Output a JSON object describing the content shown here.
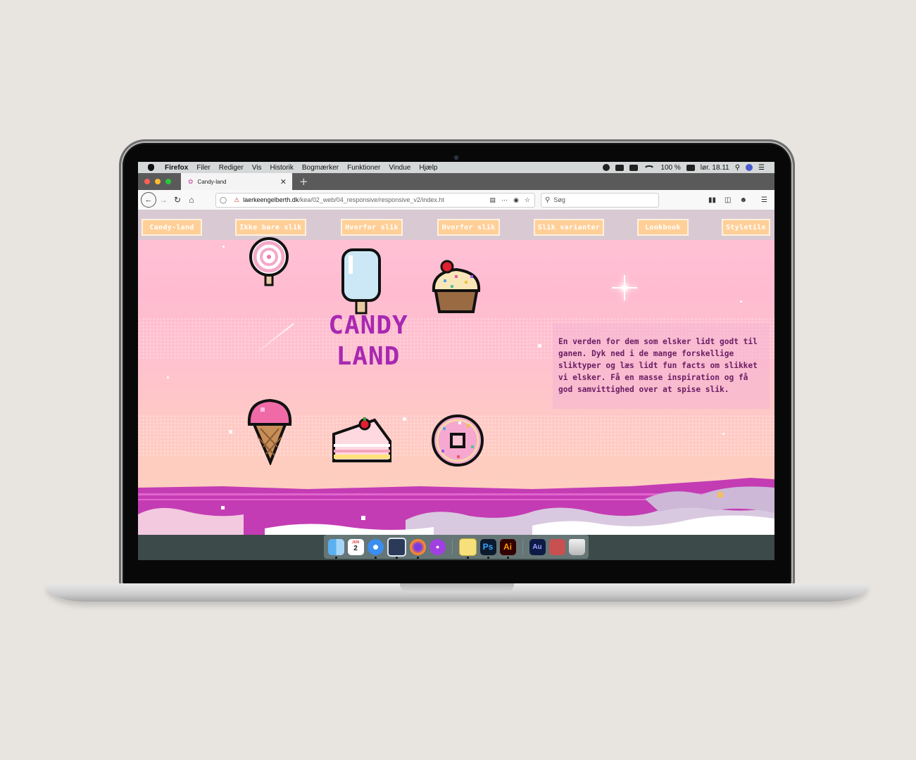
{
  "menubar": {
    "app": "Firefox",
    "items": [
      "Filer",
      "Rediger",
      "Vis",
      "Historik",
      "Bogmærker",
      "Funktioner",
      "Vindue",
      "Hjælp"
    ],
    "battery": "100 %",
    "clock": "lør. 18.11"
  },
  "browser": {
    "tab_title": "Candy-land",
    "url_domain": "laerkeengelberth.dk",
    "url_path": "/kea/02_web/04_responsive/responsive_v2/index.ht",
    "search_placeholder": "Søg"
  },
  "site": {
    "nav": [
      "Candy-land",
      "Ikke bare slik",
      "Hvorfor slik",
      "Hvorfor slik",
      "Slik varianter",
      "Lookbook",
      "Styletile"
    ],
    "title_line1": "CANDY",
    "title_line2": "LAND",
    "intro": "En verden for dem som elsker lidt godt til ganen. Dyk ned i de mange forskellige sliktyper og læs lidt fun facts om slikket vi elsker. Få en masse inspiration og få god samvittighed over at spise slik.",
    "sprites": [
      "lollipop",
      "popsicle",
      "cupcake",
      "ice-cream-cone",
      "cake-slice",
      "donut"
    ]
  },
  "dock": {
    "items": [
      "finder",
      "calendar",
      "safari",
      "preview",
      "firefox",
      "podcasts",
      "stickies",
      "Ps",
      "Ai",
      "Au",
      "printer",
      "trash"
    ],
    "calendar_day": "2",
    "calendar_month": "JUN"
  },
  "colors": {
    "accent": "#a828b2",
    "intro_text": "#6b1c63",
    "nav_button": "#ffcf97",
    "nav_bar": "#d9c9d2",
    "sky_top": "#ffc3d7",
    "sky_bottom": "#fbd0c6",
    "hills_magenta": "#c43cb4"
  }
}
